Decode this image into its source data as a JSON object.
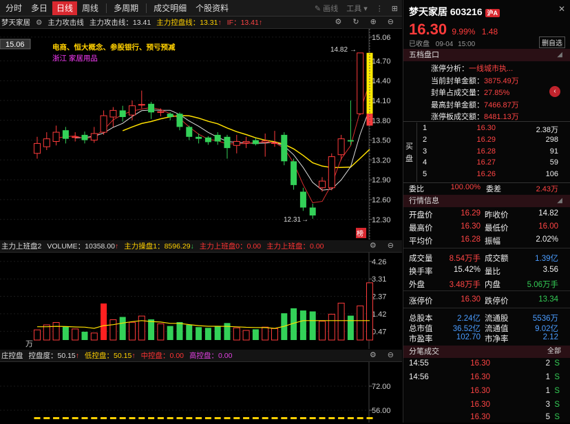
{
  "toolbar": {
    "tabs": [
      "分时",
      "多日",
      "日线",
      "周线",
      "多周期",
      "成交明细",
      "个股资料"
    ],
    "active": "日线",
    "draw": "画线",
    "tools": "工具"
  },
  "indicator_bar": {
    "stock": "梦天家居",
    "attack": "主力攻击线",
    "attack_val": "主力攻击线：13.41",
    "control": "主力控盘线：13.31",
    "control_arrow": "↑",
    "if": "IF：13.41",
    "if_arrow": "↑"
  },
  "main_chart": {
    "price_labels": [
      "15.06",
      "14.70",
      "14.40",
      "14.10",
      "13.80",
      "13.50",
      "13.20",
      "12.90",
      "12.60",
      "12.30"
    ],
    "concept_line1": "电商、恒大概念、参股银行、预亏预减",
    "concept_line2": "浙江  家居用品",
    "high_mark": "14.82",
    "low_mark": "12.31",
    "box_label": "15.06",
    "tag": "榜"
  },
  "volume_bar": {
    "name": "主力上班盘2",
    "vol": "VOLUME：10358.00",
    "vol_arrow": "↑",
    "ctl1": "主力操盘1：8596.29",
    "ctl1_arrow": "↓",
    "up0": "主力上班盘0：0.00",
    "up": "主力上班盘：0.00"
  },
  "volume_chart": {
    "labels": [
      "4.26",
      "3.31",
      "2.37",
      "1.42",
      "0.47"
    ],
    "unit": "万"
  },
  "bottom_bar": {
    "name": "庄控盘",
    "ctrl": "控盘度：50.15",
    "ctrl_arrow": "↑",
    "low": "低控盘：50.15",
    "low_arrow": "↑",
    "mid": "中控盘：0.00",
    "high": "高控盘：0.00"
  },
  "bottom_chart": {
    "labels": [
      "72.00",
      "56.00"
    ]
  },
  "quote": {
    "name": "梦天家居",
    "code": "603216",
    "badge": "沪A",
    "price": "16.30",
    "pct": "9.99%",
    "chg": "1.48",
    "status": "已收盘",
    "date": "09-04",
    "time": "15:00",
    "fav": "删自选"
  },
  "five": {
    "title": "五档盘口",
    "limit_items": [
      {
        "k": "涨停分析：",
        "v": "一线城市执..."
      },
      {
        "k": "当前封单金额：",
        "v": "3875.49万"
      },
      {
        "k": "封单占成交量：",
        "v": "27.85%"
      },
      {
        "k": "最高封单金额：",
        "v": "7466.87万"
      },
      {
        "k": "涨停板成交额：",
        "v": "8481.13万"
      }
    ],
    "buy_label": "买盘",
    "buys": [
      {
        "n": "1",
        "p": "16.30",
        "v": "2.38万"
      },
      {
        "n": "2",
        "p": "16.29",
        "v": "298"
      },
      {
        "n": "3",
        "p": "16.28",
        "v": "91"
      },
      {
        "n": "4",
        "p": "16.27",
        "v": "59"
      },
      {
        "n": "5",
        "p": "16.26",
        "v": "106"
      }
    ],
    "weibi_k": "委比",
    "weibi_v": "100.00%",
    "weicha_k": "委差",
    "weicha_v": "2.43万"
  },
  "info": {
    "title": "行情信息",
    "rows": [
      {
        "k1": "开盘价",
        "v1": "16.29",
        "k2": "昨收价",
        "v2": "14.82"
      },
      {
        "k1": "最高价",
        "v1": "16.30",
        "k2": "最低价",
        "v2": "16.00"
      },
      {
        "k1": "平均价",
        "v1": "16.28",
        "k2": "振幅",
        "v2": "2.02%"
      },
      {
        "k1": "成交量",
        "v1": "8.54万手",
        "k2": "成交额",
        "v2": "1.39亿"
      },
      {
        "k1": "换手率",
        "v1": "15.42%",
        "k2": "量比",
        "v2": "3.56"
      },
      {
        "k1": "外盘",
        "v1": "3.48万手",
        "k2": "内盘",
        "v2": "5.06万手"
      },
      {
        "k1": "涨停价",
        "v1": "16.30",
        "k2": "跌停价",
        "v2": "13.34"
      },
      {
        "k1": "总股本",
        "v1": "2.24亿",
        "k2": "流通股",
        "v2": "5536万"
      },
      {
        "k1": "总市值",
        "v1": "36.52亿",
        "k2": "流通值",
        "v2": "9.02亿"
      },
      {
        "k1": "市盈率",
        "v1": "102.70",
        "k2": "市净率",
        "v2": "2.12"
      }
    ]
  },
  "ticks": {
    "title": "分笔成交",
    "all": "全部",
    "rows": [
      {
        "t": "14:55",
        "p": "16.30",
        "v": "2",
        "s": "S"
      },
      {
        "t": "14:56",
        "p": "16.30",
        "v": "1",
        "s": "S"
      },
      {
        "t": "",
        "p": "16.30",
        "v": "1",
        "s": "S"
      },
      {
        "t": "",
        "p": "16.30",
        "v": "3",
        "s": "S"
      },
      {
        "t": "",
        "p": "16.30",
        "v": "5",
        "s": "S"
      }
    ]
  },
  "candles": [
    {
      "o": 13.3,
      "c": 13.45,
      "h": 13.55,
      "l": 13.22,
      "v": 0.55
    },
    {
      "o": 13.4,
      "c": 13.52,
      "h": 13.62,
      "l": 13.35,
      "v": 0.82
    },
    {
      "o": 13.48,
      "c": 13.62,
      "h": 13.72,
      "l": 13.42,
      "v": 0.95
    },
    {
      "o": 13.65,
      "c": 13.52,
      "h": 13.7,
      "l": 13.45,
      "v": 0.72
    },
    {
      "o": 13.55,
      "c": 13.55,
      "h": 13.62,
      "l": 13.48,
      "v": 0.6
    },
    {
      "o": 13.58,
      "c": 13.5,
      "h": 13.63,
      "l": 13.45,
      "v": 0.45
    },
    {
      "o": 13.5,
      "c": 13.6,
      "h": 13.7,
      "l": 13.46,
      "v": 0.38
    },
    {
      "o": 13.62,
      "c": 13.87,
      "h": 13.95,
      "l": 13.58,
      "v": 1.98
    },
    {
      "o": 13.85,
      "c": 13.95,
      "h": 14.0,
      "l": 13.7,
      "v": 1.1
    },
    {
      "o": 13.95,
      "c": 13.85,
      "h": 14.02,
      "l": 13.78,
      "v": 1.25
    },
    {
      "o": 13.88,
      "c": 14.02,
      "h": 14.1,
      "l": 13.8,
      "v": 0.96
    },
    {
      "o": 14.04,
      "c": 14.04,
      "h": 14.25,
      "l": 13.98,
      "v": 1.3
    },
    {
      "o": 14.05,
      "c": 13.92,
      "h": 14.08,
      "l": 13.82,
      "v": 1.12
    },
    {
      "o": 13.93,
      "c": 13.93,
      "h": 13.98,
      "l": 13.86,
      "v": 0.88
    },
    {
      "o": 13.9,
      "c": 13.85,
      "h": 13.92,
      "l": 13.8,
      "v": 0.76
    },
    {
      "o": 13.9,
      "c": 13.7,
      "h": 13.92,
      "l": 13.65,
      "v": 0.97
    },
    {
      "o": 13.7,
      "c": 13.55,
      "h": 13.72,
      "l": 13.5,
      "v": 0.82
    },
    {
      "o": 13.55,
      "c": 13.52,
      "h": 13.6,
      "l": 13.45,
      "v": 0.7
    },
    {
      "o": 13.54,
      "c": 13.47,
      "h": 13.56,
      "l": 13.43,
      "v": 0.66
    },
    {
      "o": 13.58,
      "c": 13.48,
      "h": 13.62,
      "l": 13.43,
      "v": 0.74
    },
    {
      "o": 13.55,
      "c": 13.38,
      "h": 13.58,
      "l": 13.22,
      "v": 0.92
    },
    {
      "o": 13.42,
      "c": 13.48,
      "h": 13.58,
      "l": 13.3,
      "v": 0.66
    },
    {
      "o": 13.46,
      "c": 13.48,
      "h": 13.55,
      "l": 13.38,
      "v": 0.52
    },
    {
      "o": 13.5,
      "c": 13.44,
      "h": 13.53,
      "l": 13.42,
      "v": 0.58
    },
    {
      "o": 13.47,
      "c": 13.49,
      "h": 13.6,
      "l": 13.25,
      "v": 0.7
    },
    {
      "o": 13.46,
      "c": 13.46,
      "h": 13.64,
      "l": 13.4,
      "v": 0.62
    },
    {
      "o": 13.58,
      "c": 13.18,
      "h": 13.62,
      "l": 13.12,
      "v": 1.45
    },
    {
      "o": 13.18,
      "c": 12.82,
      "h": 13.22,
      "l": 12.75,
      "v": 1.72
    },
    {
      "o": 12.72,
      "c": 12.48,
      "h": 12.78,
      "l": 12.43,
      "v": 1.6
    },
    {
      "o": 12.48,
      "c": 12.36,
      "h": 12.54,
      "l": 12.31,
      "v": 1.55
    },
    {
      "o": 12.78,
      "c": 12.88,
      "h": 12.94,
      "l": 12.72,
      "v": 1.02
    },
    {
      "o": 12.78,
      "c": 13.25,
      "h": 13.3,
      "l": 12.74,
      "v": 1.4
    },
    {
      "o": 13.28,
      "c": 13.52,
      "h": 13.58,
      "l": 13.2,
      "v": 2.0
    },
    {
      "o": 13.5,
      "c": 13.48,
      "h": 14.1,
      "l": 13.42,
      "v": 1.32
    },
    {
      "o": 13.9,
      "c": 14.82,
      "h": 14.82,
      "l": 13.88,
      "v": 1.85
    },
    {
      "o": 14.82,
      "c": 14.82,
      "h": 14.82,
      "l": 14.82,
      "v": 3.1
    }
  ]
}
